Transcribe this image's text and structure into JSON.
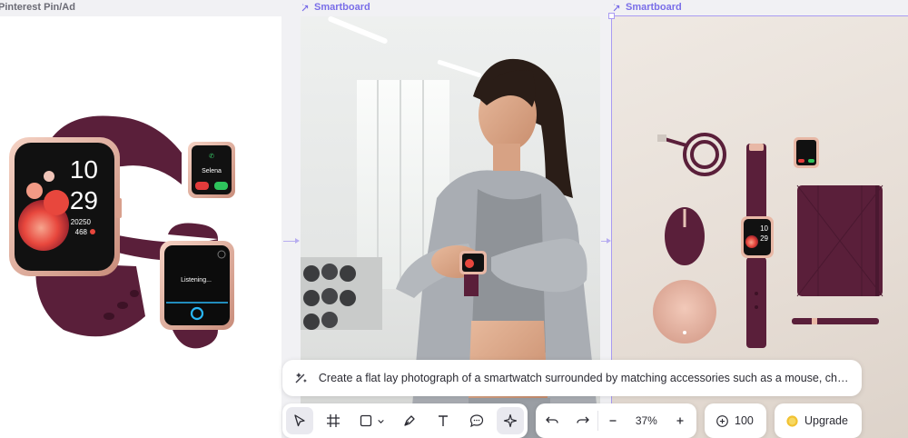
{
  "frames": [
    {
      "label": "Pinterest Pin/Ad"
    },
    {
      "label": "Smartboard"
    },
    {
      "label": "Smartboard"
    }
  ],
  "watch_main": {
    "time_hours": "10",
    "time_minutes": "29",
    "steps": "20250",
    "heart_rate": "468"
  },
  "watch_call": {
    "caller": "Selena"
  },
  "watch_voice": {
    "status": "Listening..."
  },
  "prompt": {
    "text": "Create a flat lay photograph of a smartwatch surrounded by matching accessories such as a mouse, charger, and n..."
  },
  "toolbar": {
    "zoom": "37%",
    "credits": "100",
    "upgrade_label": "Upgrade"
  },
  "colors": {
    "accent": "#7a6ee8",
    "plum": "#5a1f3a",
    "rose_gold": "#e7b9a6",
    "upgrade_coin": "#f1c232"
  }
}
